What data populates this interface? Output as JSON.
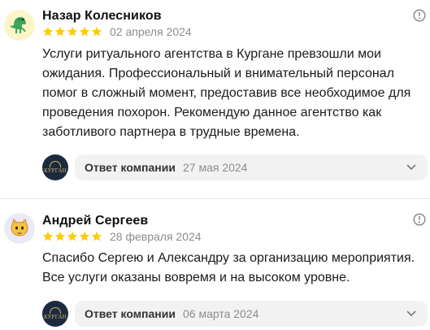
{
  "reviews": [
    {
      "author": "Назар Колесников",
      "avatar_icon": "dinosaur-icon",
      "rating": 5,
      "date": "02 апреля 2024",
      "text": "Услуги ритуального агентства в Кургане превзошли мои ожидания. Профессиональный и внимательный персонал помог в сложный момент, предоставив все необходимое для проведения похорон. Рекомендую данное агентство как заботливого партнера в трудные времена.",
      "company_logo_text": "КУРГАН",
      "reply_label": "Ответ компании",
      "reply_date": "27 мая 2024"
    },
    {
      "author": "Андрей Сергеев",
      "avatar_icon": "cat-icon",
      "rating": 5,
      "date": "28 февраля 2024",
      "text": "Спасибо Сергею и Александру за организацию мероприятия. Все услуги оказаны вовремя и на высоком уровне.",
      "company_logo_text": "КУРГАН",
      "reply_label": "Ответ компании",
      "reply_date": "06 марта 2024"
    }
  ],
  "colors": {
    "star": "#fc0",
    "company_logo_bg": "#1c2a3d",
    "reply_bg": "#f2f2f2",
    "muted_text": "#8c8c8c"
  },
  "icons": {
    "info": "info-icon",
    "chevron": "chevron-down-icon",
    "star": "star-icon"
  }
}
